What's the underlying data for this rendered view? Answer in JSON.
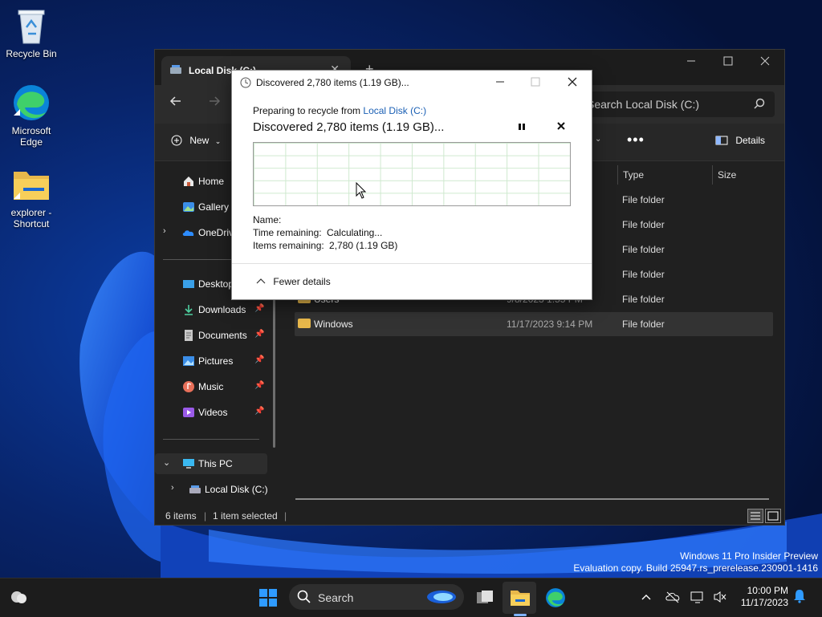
{
  "desktop": {
    "icons": [
      {
        "label": "Recycle Bin"
      },
      {
        "label": "Microsoft Edge"
      },
      {
        "label": "explorer - Shortcut"
      }
    ]
  },
  "explorer": {
    "tab_title": "Local Disk (C:)",
    "tab_close": "✕",
    "new_tab": "+",
    "search_placeholder": "Search Local Disk (C:)",
    "toolbar": {
      "new_label": "New",
      "more": "•••",
      "details_label": "Details"
    },
    "sidebar": {
      "home": "Home",
      "gallery": "Gallery",
      "onedrive": "OneDrive",
      "desktop": "Desktop",
      "downloads": "Downloads",
      "documents": "Documents",
      "pictures": "Pictures",
      "music": "Music",
      "videos": "Videos",
      "this_pc": "This PC",
      "local_disk": "Local Disk (C:)"
    },
    "columns": {
      "type": "Type",
      "size": "Size"
    },
    "rows": [
      {
        "type": "File folder"
      },
      {
        "type": "File folder"
      },
      {
        "type": "File folder"
      },
      {
        "type": "File folder"
      },
      {
        "name": "Users",
        "date": "9/8/2023 1:55 PM",
        "type": "File folder"
      },
      {
        "name": "Windows",
        "date": "11/17/2023 9:14 PM",
        "type": "File folder"
      }
    ],
    "status": {
      "items": "6 items",
      "selected": "1 item selected"
    }
  },
  "dialog": {
    "title": "Discovered 2,780 items (1.19 GB)...",
    "from_prefix": "Preparing to recycle from ",
    "from_link": "Local Disk (C:)",
    "status": "Discovered 2,780 items (1.19 GB)...",
    "name_label": "Name:",
    "time_label": "Time remaining:",
    "time_value": "Calculating...",
    "items_label": "Items remaining:",
    "items_value": "2,780 (1.19 GB)",
    "fewer_details": "Fewer details"
  },
  "watermark": {
    "line1": "Windows 11 Pro Insider Preview",
    "line2": "Evaluation copy. Build 25947.rs_prerelease.230901-1416"
  },
  "taskbar": {
    "search_label": "Search",
    "time": "10:00 PM",
    "date": "11/17/2023"
  },
  "colors": {
    "accent": "#1a5fb4",
    "folder": "#e8b84b",
    "taskbar": "#1c1c1c"
  }
}
